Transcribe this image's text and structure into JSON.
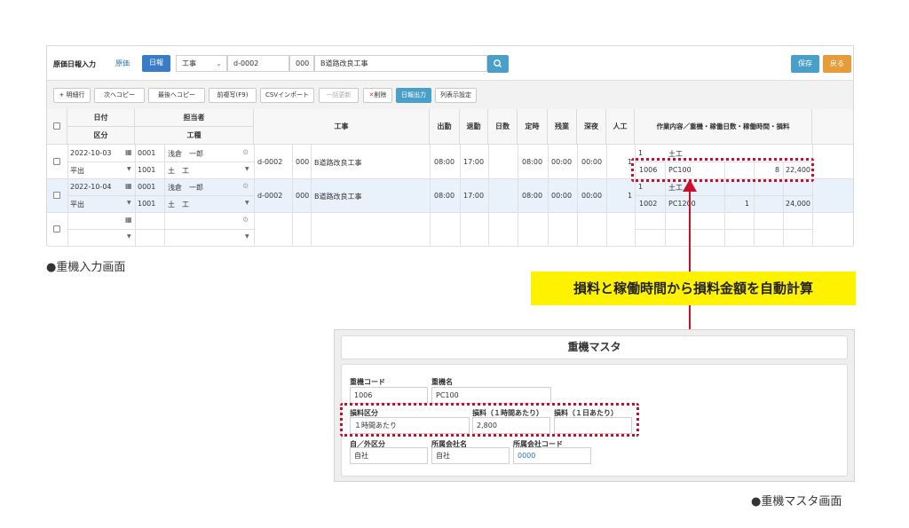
{
  "main": {
    "title": "原価日報入力",
    "link_genka": "原価",
    "btn_nippou": "日報",
    "type_select": "工事",
    "code": "d-0002",
    "sub": "000",
    "project_name": "B道路改良工事",
    "save": "保存",
    "back": "戻る",
    "toolbar": [
      "+ 明細行",
      "次へコピー",
      "最後へコピー",
      "前複写(F9)",
      "CSVインポート",
      "一括更新",
      "削除",
      "日報出力",
      "列表示設定"
    ],
    "headers": {
      "date": "日付",
      "kubun": "区分",
      "tantou": "担当者",
      "koushu": "工種",
      "kouji": "工事",
      "shukkin": "出勤",
      "taikin": "退勤",
      "nissu": "日数",
      "teiji": "定時",
      "zangyo": "残業",
      "shinya": "深夜",
      "ninku": "人工",
      "sagyou": "作業内容／重機・稼働日数・稼働時間・損料"
    },
    "rows": [
      {
        "date": "2022-10-03",
        "kubun": "平出",
        "emp_code": "0001",
        "emp_name": "浅倉　一郎",
        "kou_code": "1001",
        "kou_name": "土　工",
        "code": "d-0002",
        "sub": "000",
        "name": "B道路改良工事",
        "in": "08:00",
        "out": "17:00",
        "teiji": "08:00",
        "zangyo": "00:00",
        "shinya": "00:00",
        "ninku": "1",
        "work_no": "1",
        "work_name": "土工",
        "mach_code": "1006",
        "mach_name": "PC100",
        "mach_hours": "8",
        "mach_cost": "22,400"
      },
      {
        "date": "2022-10-04",
        "kubun": "平出",
        "emp_code": "0001",
        "emp_name": "浅倉　一郎",
        "kou_code": "1001",
        "kou_name": "土　工",
        "code": "d-0002",
        "sub": "000",
        "name": "B道路改良工事",
        "in": "08:00",
        "out": "17:00",
        "teiji": "08:00",
        "zangyo": "00:00",
        "shinya": "00:00",
        "ninku": "1",
        "work_no": "1",
        "work_name": "土工",
        "mach_code": "1002",
        "mach_name": "PC1200",
        "mach_days": "1",
        "mach_cost": "24,000"
      }
    ]
  },
  "caption_main": "●重機入力画面",
  "callout": "損料と稼働時間から損料金額を自動計算",
  "master": {
    "title": "重機マスタ",
    "lbl_code": "重機コード",
    "code": "1006",
    "lbl_name": "重機名",
    "name": "PC100",
    "lbl_kubun": "損料区分",
    "kubun": "１時間あたり",
    "lbl_hour": "損料（１時間あたり）",
    "hour": "2,800",
    "lbl_day": "損料（１日あたり）",
    "day": "",
    "lbl_own": "自／外区分",
    "own": "自社",
    "lbl_company": "所属会社名",
    "company": "自社",
    "lbl_company_code": "所属会社コード",
    "company_code": "0000"
  },
  "caption_master": "●重機マスタ画面",
  "colors": {
    "accent": "#3a7bc8",
    "save": "#4a9fc9",
    "back": "#e79c3a",
    "highlight": "#c8102e",
    "callout": "#fff200"
  }
}
